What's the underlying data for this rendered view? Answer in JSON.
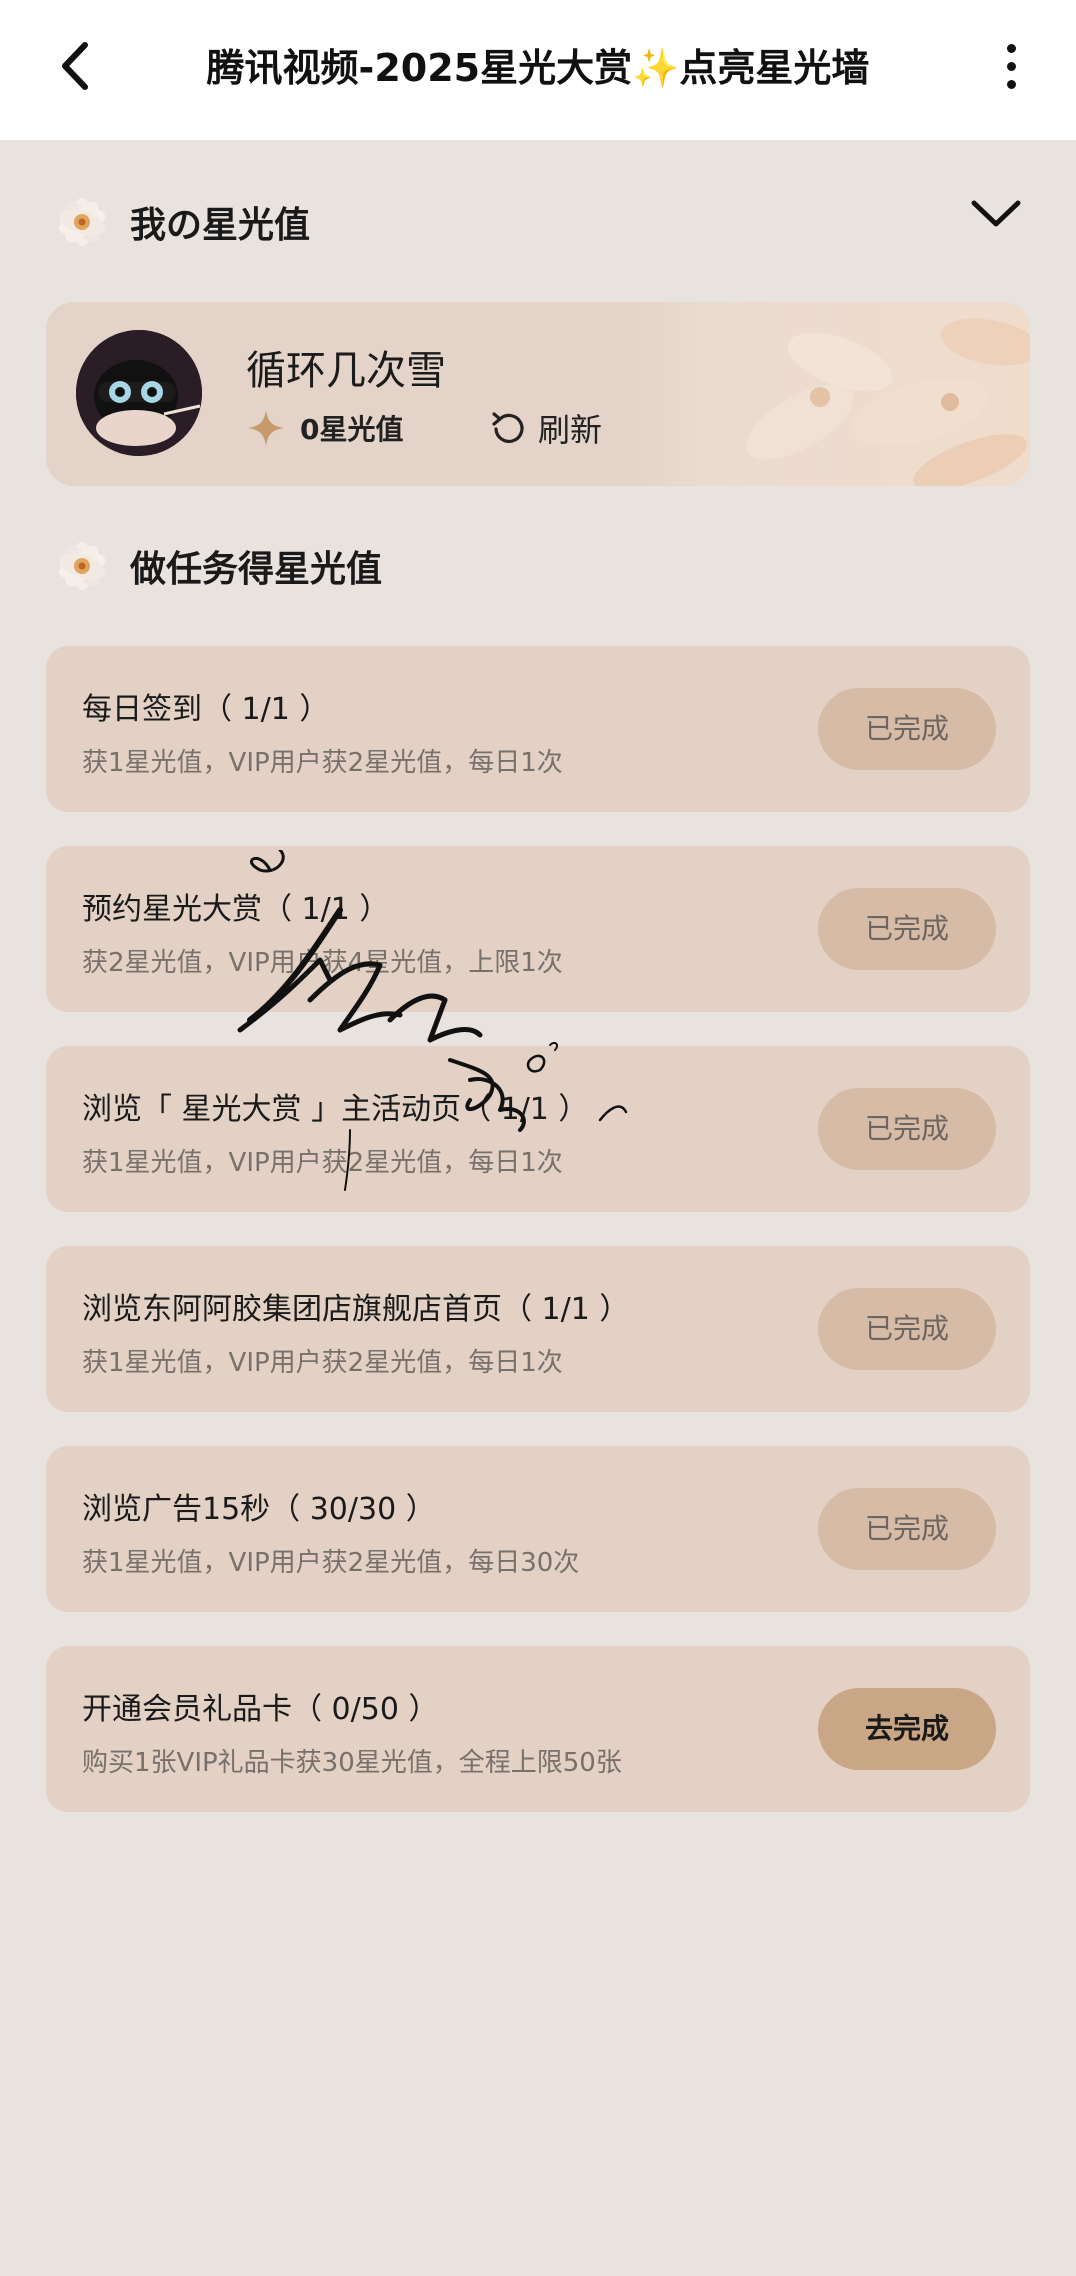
{
  "header": {
    "title_prefix": "腾讯视频-2025星光大赏",
    "title_spark": "✨",
    "title_suffix": "点亮星光墙"
  },
  "my_stars": {
    "section_title": "我の星光值",
    "username": "循环几次雪",
    "star_label": "0星光值",
    "refresh_label": "刷新"
  },
  "tasks_section": {
    "title": "做任务得星光值",
    "items": [
      {
        "title": "每日签到（ 1/1 ）",
        "desc": "获1星光值，VIP用户获2星光值，每日1次",
        "button": "已完成",
        "done": true
      },
      {
        "title": "预约星光大赏（ 1/1 ）",
        "desc": "获2星光值，VIP用户获4星光值，上限1次",
        "button": "已完成",
        "done": true
      },
      {
        "title": "浏览「 星光大赏 」主活动页（ 1/1 ）",
        "desc": "获1星光值，VIP用户获2星光值，每日1次",
        "button": "已完成",
        "done": true
      },
      {
        "title": "浏览东阿阿胶集团店旗舰店首页（ 1/1 ）",
        "desc": "获1星光值，VIP用户获2星光值，每日1次",
        "button": "已完成",
        "done": true
      },
      {
        "title": "浏览广告15秒（ 30/30 ）",
        "desc": "获1星光值，VIP用户获2星光值，每日30次",
        "button": "已完成",
        "done": true
      },
      {
        "title": "开通会员礼品卡（ 0/50 ）",
        "desc": "购买1张VIP礼品卡获30星光值，全程上限50张",
        "button": "去完成",
        "done": false
      }
    ]
  },
  "colors": {
    "page_bg": "#e9e3df",
    "card_bg": "#e2d1c4",
    "done_button": "#d6bba6",
    "active_button": "#c9a686",
    "star_gold": "#c79a6a"
  },
  "signature_text": "循环几次雪"
}
